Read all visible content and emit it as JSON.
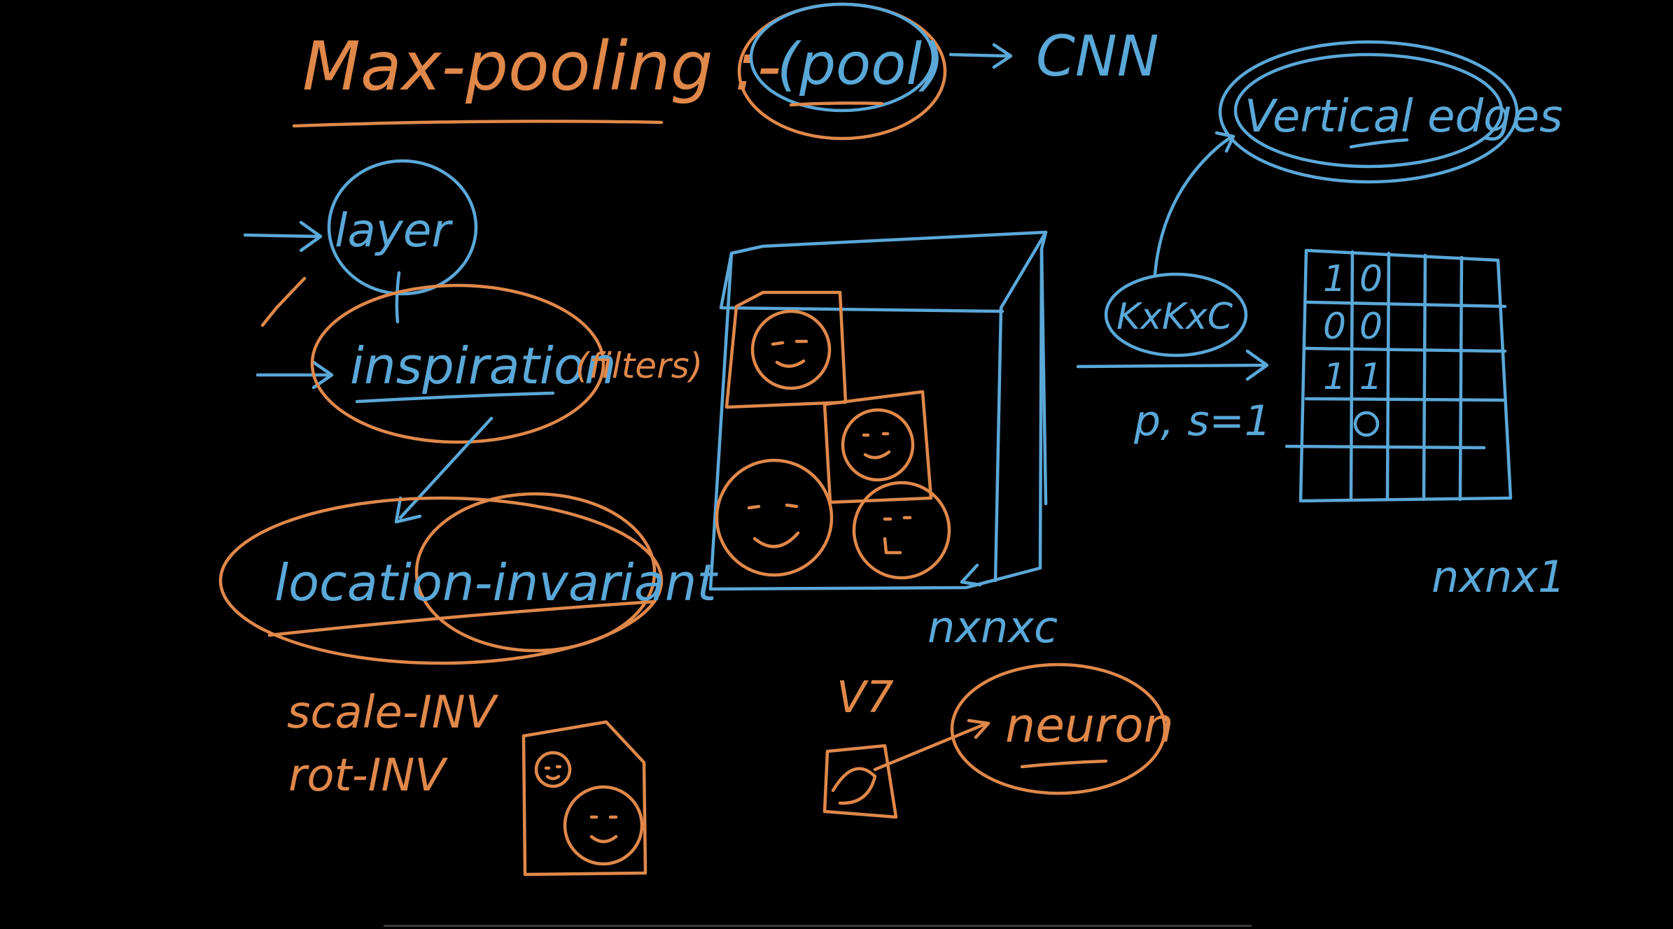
{
  "colors": {
    "background": "#000000",
    "orange_ink": "#e0884a",
    "blue_ink": "#5aa8d8"
  },
  "notes": {
    "title": "Max-pooling :-",
    "pool": "(pool)",
    "cnn": "CNN",
    "layer": "layer",
    "inspiration": "inspiration",
    "filters": "(filters)",
    "location_invariant": "location-invariant",
    "scale_inv": "scale-INV",
    "rot_inv": "rot-INV",
    "v7": "V7",
    "neuron": "neuron",
    "volume_dims": "nxnxc",
    "kernel": "KxKxC",
    "params": "p, s=1",
    "vertical_edges": "Vertical edges",
    "output_dims": "nxnx1"
  },
  "grid": {
    "cells": [
      [
        "1",
        "0"
      ],
      [
        "0",
        "0"
      ],
      [
        "1",
        "1"
      ]
    ]
  }
}
